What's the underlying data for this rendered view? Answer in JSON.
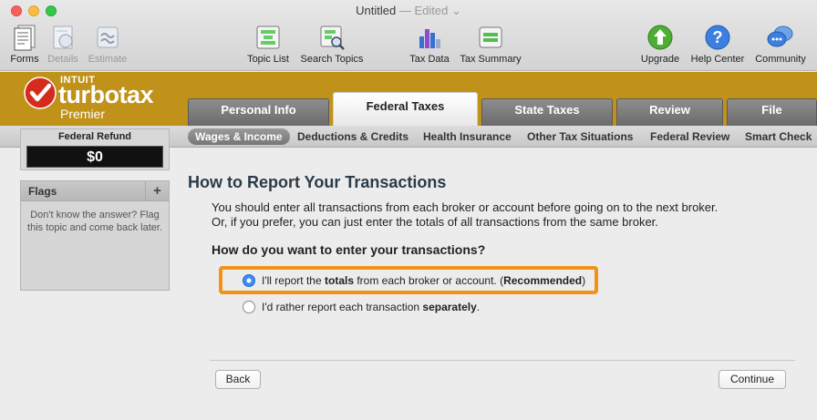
{
  "window": {
    "title": "Untitled",
    "edited": "— Edited ⌄"
  },
  "toolbar": {
    "left": [
      {
        "label": "Forms",
        "icon": "forms-icon",
        "enabled": true
      },
      {
        "label": "Details",
        "icon": "details-icon",
        "enabled": false
      },
      {
        "label": "Estimate",
        "icon": "estimate-icon",
        "enabled": false
      }
    ],
    "center": [
      {
        "label": "Topic List",
        "icon": "topic-list-icon"
      },
      {
        "label": "Search Topics",
        "icon": "search-topics-icon"
      },
      {
        "label": "Tax Data",
        "icon": "tax-data-icon"
      },
      {
        "label": "Tax Summary",
        "icon": "tax-summary-icon"
      }
    ],
    "right": [
      {
        "label": "Upgrade",
        "icon": "upgrade-icon"
      },
      {
        "label": "Help Center",
        "icon": "help-center-icon"
      },
      {
        "label": "Community",
        "icon": "community-icon"
      }
    ]
  },
  "brand": {
    "intuit": "INTUIT",
    "name": "turbotax",
    "edition": "Premier",
    "color": "#c0921a"
  },
  "main_tabs": [
    {
      "label": "Personal Info",
      "active": false
    },
    {
      "label": "Federal Taxes",
      "active": true
    },
    {
      "label": "State Taxes",
      "active": false
    },
    {
      "label": "Review",
      "active": false
    },
    {
      "label": "File",
      "active": false
    }
  ],
  "sub_tabs": [
    {
      "label": "Wages & Income",
      "active": true
    },
    {
      "label": "Deductions & Credits",
      "active": false
    },
    {
      "label": "Health Insurance",
      "active": false
    },
    {
      "label": "Other Tax Situations",
      "active": false
    },
    {
      "label": "Federal Review",
      "active": false
    },
    {
      "label": "Smart Check",
      "active": false
    }
  ],
  "sidebar": {
    "refund_label": "Federal Refund",
    "refund_value": "$0",
    "flags_title": "Flags",
    "flags_add": "+",
    "flags_message": "Don't know the answer? Flag this topic and come back later."
  },
  "main": {
    "title": "How to Report Your Transactions",
    "intro_line1": "You should enter all transactions from each broker or account before going on to the next broker.",
    "intro_line2": "Or, if you prefer, you can just enter the totals of all transactions from the same broker.",
    "question": "How do you want to enter your transactions?",
    "option1": {
      "pre": "I'll report the ",
      "bold": "totals",
      "mid": " from each broker or account. (",
      "bold2": "Recommended",
      "post": ")",
      "selected": true
    },
    "option2": {
      "pre": "I'd rather report each transaction ",
      "bold": "separately",
      "post": ".",
      "selected": false
    },
    "highlight_color": "#f29218",
    "back_label": "Back",
    "continue_label": "Continue"
  }
}
